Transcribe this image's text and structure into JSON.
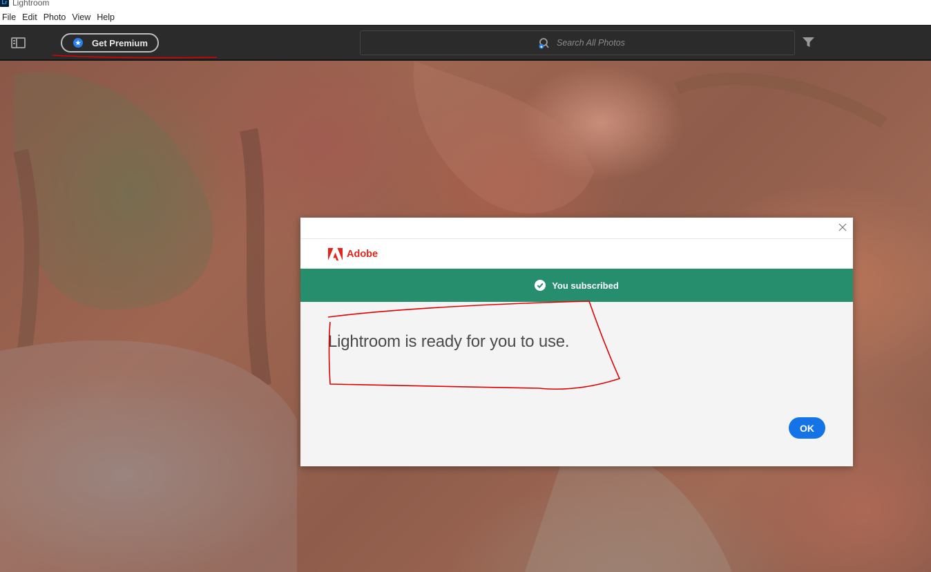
{
  "window": {
    "app_logo": "Lr",
    "title": "Lightroom"
  },
  "menu": {
    "items": [
      {
        "label": "File"
      },
      {
        "label": "Edit"
      },
      {
        "label": "Photo"
      },
      {
        "label": "View"
      },
      {
        "label": "Help"
      }
    ]
  },
  "toolbar": {
    "panel_toggle_icon": "sidebar-panel-icon",
    "premium_label": "Get Premium",
    "premium_icon": "star-icon",
    "search_placeholder": "Search All Photos",
    "search_icon": "search-people-icon",
    "filter_icon": "filter-funnel-icon"
  },
  "dialog": {
    "brand": "Adobe",
    "banner_text": "You subscribed",
    "banner_icon": "checkmark-circle-icon",
    "message": "Lightroom is ready for you to use.",
    "ok_label": "OK",
    "close_icon": "close-icon"
  },
  "colors": {
    "toolbar_bg": "#2b2b2b",
    "banner_green": "#268e6c",
    "adobe_red": "#e1251b",
    "ok_blue": "#1473e6",
    "annotation_red": "#e00000"
  }
}
